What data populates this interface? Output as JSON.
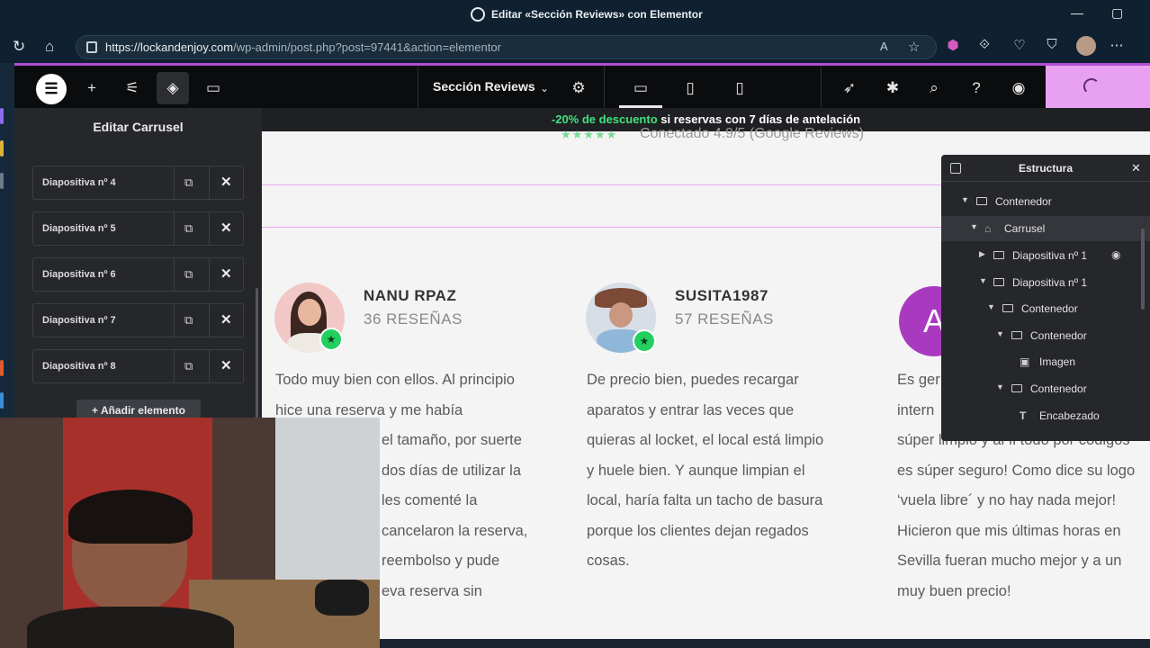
{
  "window": {
    "title": "Editar «Sección Reviews» con Elementor"
  },
  "browser": {
    "url_main": "https://lockandenjoy.com",
    "url_rest": "/wp-admin/post.php?post=97441&action=elementor"
  },
  "editor": {
    "document_name": "Sección Reviews",
    "panel_title": "Editar Carrusel",
    "slides": [
      {
        "label": "Diapositiva nº 4"
      },
      {
        "label": "Diapositiva nº 5"
      },
      {
        "label": "Diapositiva nº 6"
      },
      {
        "label": "Diapositiva nº 7"
      },
      {
        "label": "Diapositiva nº 8"
      }
    ],
    "add_button": "Añadir elemento"
  },
  "notice": {
    "highlight": "-20% de descuento",
    "rest": " si reservas con 7 días de antelación"
  },
  "canvas": {
    "rating_partial": "Conectado 4.9/5 (Google Reviews)",
    "reviews": [
      {
        "name": "NANU RPAZ",
        "count": "36 RESEÑAS",
        "lines": [
          "Todo muy bien con ellos. Al principio",
          "hice una reserva y me había",
          "el tamaño, por suerte",
          "dos días de utilizar la",
          "les comenté la",
          "cancelaron la reserva,",
          "reembolso y pude",
          "eva reserva sin"
        ]
      },
      {
        "name": "SUSITA1987",
        "count": "57 RESEÑAS",
        "lines": [
          "De precio bien, puedes recargar",
          "aparatos y entrar las veces que",
          "quieras al locket, el local está limpio",
          "y huele bien. Y aunque limpian el",
          "local, haría falta un tacho de basura",
          "porque los clientes dejan regados",
          "cosas."
        ]
      },
      {
        "initial": "A",
        "lines": [
          "Es ger",
          "intern",
          "súper limpio y al fi todo por códigos",
          "es súper seguro! Como dice su logo",
          "‘vuela libre´ y no hay nada mejor!",
          "Hicieron que mis últimas horas en",
          "Sevilla fueran mucho mejor y a un",
          "muy buen precio!"
        ]
      }
    ]
  },
  "structure": {
    "title": "Estructura",
    "nodes": [
      {
        "label": "Contenedor"
      },
      {
        "label": "Carrusel"
      },
      {
        "label": "Diapositiva nº 1"
      },
      {
        "label": "Diapositiva nº 1"
      },
      {
        "label": "Contenedor"
      },
      {
        "label": "Contenedor"
      },
      {
        "label": "Imagen"
      },
      {
        "label": "Contenedor"
      },
      {
        "label": "Encabezado"
      }
    ]
  },
  "colors": {
    "accent": "#e7a1f0",
    "notice_highlight": "#3fe27a",
    "badge": "#23cf5f"
  }
}
